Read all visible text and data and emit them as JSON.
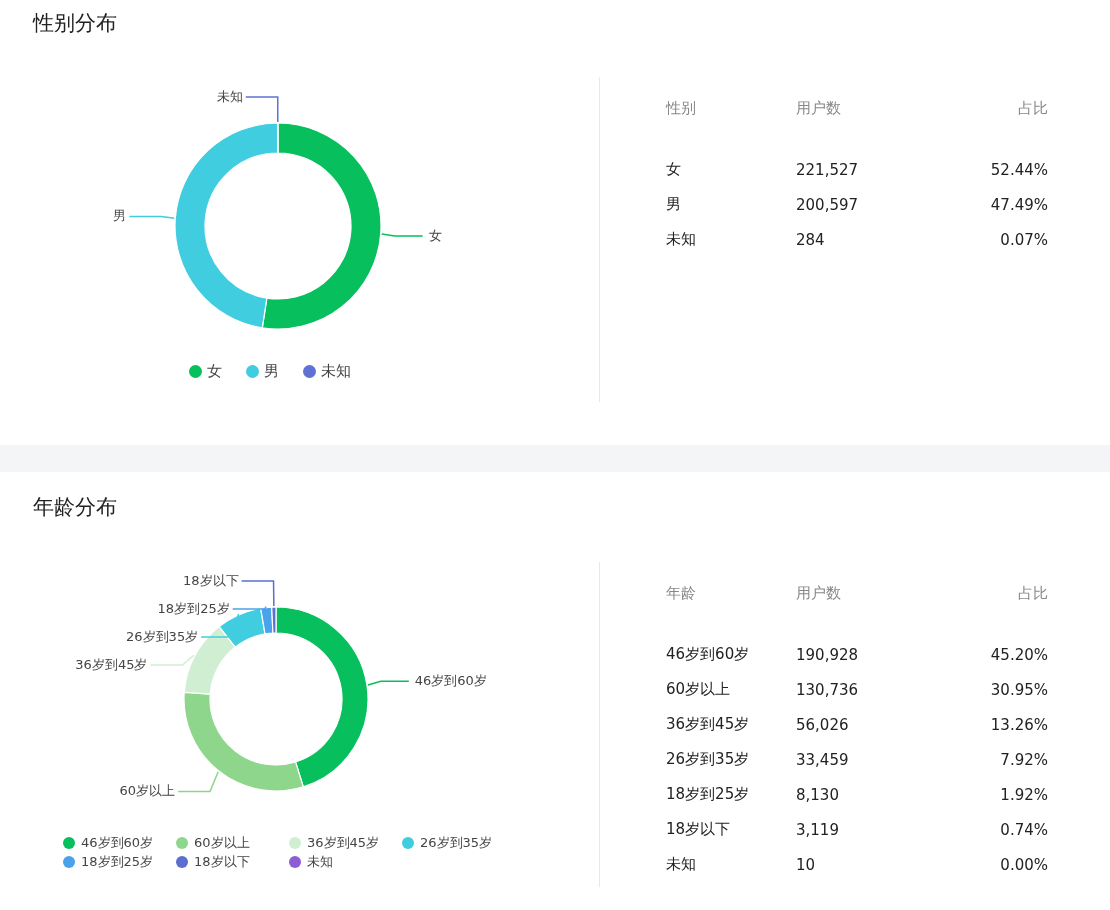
{
  "sections": [
    {
      "title": "性别分布",
      "chart_data": {
        "type": "donut",
        "categories": [
          "女",
          "男",
          "未知"
        ],
        "series": [
          {
            "values": [
              52.44,
              47.49,
              0.07
            ]
          }
        ]
      },
      "legend": [
        {
          "label": "女",
          "color": "#07bf5c"
        },
        {
          "label": "男",
          "color": "#40cde0"
        },
        {
          "label": "未知",
          "color": "#5f72d4"
        }
      ],
      "table": {
        "columns": [
          "性别",
          "用户数",
          "占比"
        ],
        "rows": [
          [
            "女",
            "221,527",
            "52.44%"
          ],
          [
            "男",
            "200,597",
            "47.49%"
          ],
          [
            "未知",
            "284",
            "0.07%"
          ]
        ]
      }
    },
    {
      "title": "年龄分布",
      "chart_data": {
        "type": "donut",
        "categories": [
          "46岁到60岁",
          "60岁以上",
          "36岁到45岁",
          "26岁到35岁",
          "18岁到25岁",
          "18岁以下"
        ],
        "series": [
          {
            "values": [
              45.2,
              30.95,
              13.26,
              7.92,
              1.92,
              0.74
            ]
          }
        ]
      },
      "legend": [
        {
          "label": "46岁到60岁",
          "color": "#07bf5c"
        },
        {
          "label": "60岁以上",
          "color": "#8ed68b"
        },
        {
          "label": "36岁到45岁",
          "color": "#d0efd2"
        },
        {
          "label": "26岁到35岁",
          "color": "#40cde0"
        },
        {
          "label": "18岁到25岁",
          "color": "#4aa3ea"
        },
        {
          "label": "18岁以下",
          "color": "#5a6fcf"
        },
        {
          "label": "未知",
          "color": "#8d5ed3"
        }
      ],
      "table": {
        "columns": [
          "年龄",
          "用户数",
          "占比"
        ],
        "rows": [
          [
            "46岁到60岁",
            "190,928",
            "45.20%"
          ],
          [
            "60岁以上",
            "130,736",
            "30.95%"
          ],
          [
            "36岁到45岁",
            "56,026",
            "13.26%"
          ],
          [
            "26岁到35岁",
            "33,459",
            "7.92%"
          ],
          [
            "18岁到25岁",
            "8,130",
            "1.92%"
          ],
          [
            "18岁以下",
            "3,119",
            "0.74%"
          ],
          [
            "未知",
            "10",
            "0.00%"
          ]
        ]
      }
    }
  ]
}
